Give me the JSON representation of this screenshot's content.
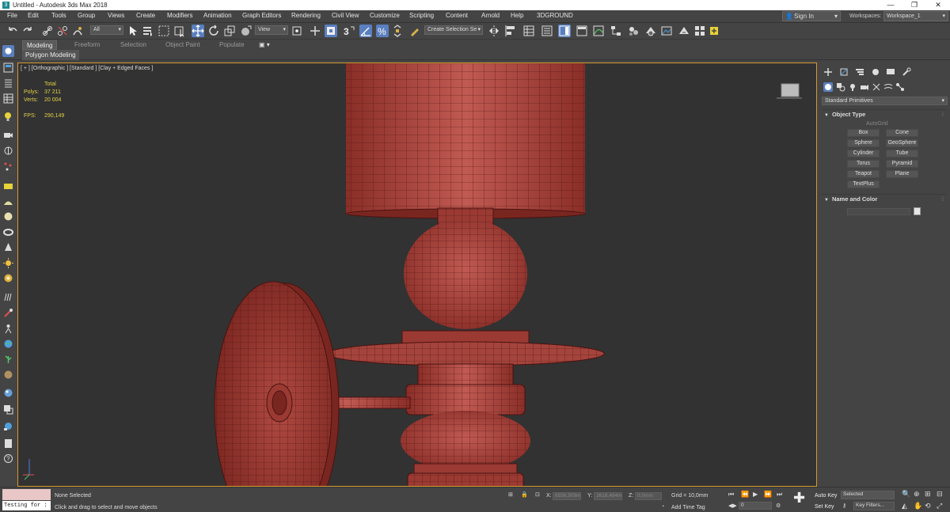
{
  "window": {
    "title": "Untitled - Autodesk 3ds Max 2018"
  },
  "menu": [
    "File",
    "Edit",
    "Tools",
    "Group",
    "Views",
    "Create",
    "Modifiers",
    "Animation",
    "Graph Editors",
    "Rendering",
    "Civil View",
    "Customize",
    "Scripting",
    "Content",
    "Arnold",
    "Help",
    "3DGROUND"
  ],
  "account": {
    "sign_in": "Sign In",
    "workspaces_label": "Workspaces:",
    "workspace": "Workspace_1"
  },
  "toolbar": {
    "filter": "All",
    "ref_coord": "View",
    "selection_set": "Create Selection Se"
  },
  "ribbon": {
    "tabs": [
      "Modeling",
      "Freeform",
      "Selection",
      "Object Paint",
      "Populate"
    ],
    "active": "Modeling",
    "sub": "Polygon Modeling"
  },
  "viewport": {
    "label": "[ + ] [Orthographic ] [Standard ] [Clay + Edged Faces ]",
    "stats": {
      "total_label": "Total",
      "polys_label": "Polys:",
      "polys": "37 211",
      "verts_label": "Verts:",
      "verts": "20 004",
      "fps_label": "FPS:",
      "fps": "290,149"
    }
  },
  "command_panel": {
    "category": "Standard Primitives",
    "object_type_title": "Object Type",
    "autogrid": "AutoGrid",
    "buttons": [
      "Box",
      "Cone",
      "Sphere",
      "GeoSphere",
      "Cylinder",
      "Tube",
      "Torus",
      "Pyramid",
      "Teapot",
      "Plane",
      "TextPlus"
    ],
    "name_color_title": "Name and Color"
  },
  "status": {
    "maxscript": "Testing for :",
    "selection": "None Selected",
    "prompt": "Click and drag to select and move objects",
    "x_label": "X:",
    "x": "6556,509m",
    "y_label": "Y:",
    "y": "2618,484m",
    "z_label": "Z:",
    "z": "0,0mm",
    "grid": "Grid = 10,0mm",
    "add_time_tag": "Add Time Tag",
    "frame": "0",
    "auto_key": "Auto Key",
    "set_key": "Set Key",
    "key_mode": "Selected",
    "key_filters": "Key Filters..."
  },
  "colors": {
    "model": "#a8403a",
    "wire": "#4a1210",
    "accent": "#5a7fbf",
    "active_border": "#d59a2e",
    "stats": "#e3d145"
  }
}
